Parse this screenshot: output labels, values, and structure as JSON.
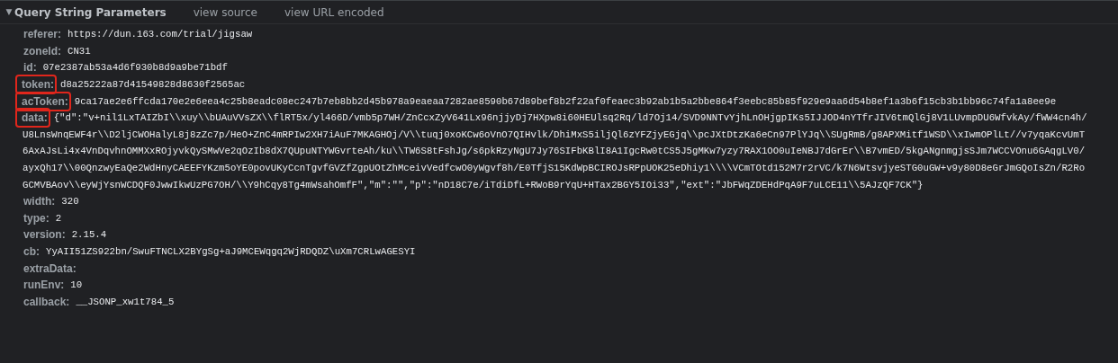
{
  "section": {
    "toggle": "▼",
    "title": "Query String Parameters",
    "expanded": true,
    "links": [
      "view source",
      "view URL encoded"
    ]
  },
  "params": [
    {
      "key": "referer:",
      "value_lines": [
        "https://dun.163.com/trial/jigsaw"
      ],
      "highlighted": false
    },
    {
      "key": "zoneId:",
      "value_lines": [
        "CN31"
      ],
      "highlighted": false
    },
    {
      "key": "id:",
      "value_lines": [
        "07e2387ab53a4d6f930b8d9a9be71bdf"
      ],
      "highlighted": false
    },
    {
      "key": "token:",
      "value_lines": [
        "d8a25222a87d41549828d8630f2565ac"
      ],
      "highlighted": true
    },
    {
      "key": "acToken:",
      "value_lines": [
        "9ca17ae2e6ffcda170e2e6eea4c25b8eadc08ec247b7eb8bb2d45b978a9eaeaa7282ae8590b67d89bef8b2f22af0feaec3b92ab1b5a2bbe864f3eebc85b85f929e9aa6d54b8ef1a3b6f15cb3b1bb96c74fa1a8ee9e"
      ],
      "highlighted": true
    },
    {
      "key": "data:",
      "value_lines": [
        "{\"d\":\"v+nil1LxTAIZbI\\\\xuy\\\\bUAuVVsZX\\\\flRT5x/yl466D/vmb5p7WH/ZnCcxZyV641Lx96njjyDj7HXpw8i60HEUlsq2Rq/ld7Oj14/SVD9NNTvYjhLnOHjgpIKs5IJJOD4nYTfrJIV6tmQlGj8V1LUvmpDU6WfvkAy/fWW4cn4h/",
        "U8LnsWnqEWF4r\\\\D2ljCWOHalyL8j8zZc7p/HeO+ZnC4mRPIw2XH7iAuF7MKAGHOj/V\\\\tuqj0xoKCw6oVnO7QIHvlk/DhiMxS5iljQl6zYFZjyEGjq\\\\pcJXtDtzKa6eCn97PlYJq\\\\SUgRmB/g8APXMitf1WSD\\\\xIwmOPlLt//v7yqaKcvUmT",
        "6AxAJsLi4x4VnDqvhnOMMXxROjyvkQySMwVe2qOzIb8dX7QUpuNTYWGvrteAh/ku\\\\TW6S8tFshJg/s6pkRzyNgU7Jy76SIFbKBlI8A1IgcRw0tCS5J5gMKw7yzy7RAX1OO0uIeNBJ7dGrEr\\\\B7vmED/5kgANgnmgjsSJm7WCCVOnu6GAqgLV0/",
        "ayxQh17\\\\00QnzwyEaQe2WdHnyCAEEFYKzm5oYE0povUKyCcnTgvfGVZfZgpUOtZhMceivVedfcwO0yWgvf8h/E0TfjS15KdWpBCIROJsRPpUOK25eDhiy1\\\\\\\\VCmTOtd152M7r2rVC/k7N6WtsvjyeSTG0uGW+v9y80D8eGrJmGQoIsZn/R2Ro",
        "GCMVBAov\\\\eyWjYsnWCDQF0JwwIkwUzPG7OH/\\\\Y9hCqy8Tg4mWsahOmfF\",\"m\":\"\",\"p\":\"nD18C7e/iTdiDfL+RWoB9rYqU+HTax2BGY5IOi33\",\"ext\":\"JbFWqZDEHdPqA9F7uLCE11\\\\5AJzQF7CK\"}"
      ],
      "highlighted": true
    },
    {
      "key": "width:",
      "value_lines": [
        "320"
      ],
      "highlighted": false
    },
    {
      "key": "type:",
      "value_lines": [
        "2"
      ],
      "highlighted": false
    },
    {
      "key": "version:",
      "value_lines": [
        "2.15.4"
      ],
      "highlighted": false
    },
    {
      "key": "cb:",
      "value_lines": [
        "YyAII51ZS922bn/SwuFTNCLX2BYgSg+aJ9MCEWqgq2WjRDQDZ\\uXm7CRLwAGESYI"
      ],
      "highlighted": false
    },
    {
      "key": "extraData:",
      "highlighted": false
    },
    {
      "key": "runEnv:",
      "value_lines": [
        "10"
      ],
      "highlighted": false
    },
    {
      "key": "callback:",
      "value_lines": [
        "__JSONP_xw1t784_5"
      ],
      "highlighted": false
    }
  ]
}
